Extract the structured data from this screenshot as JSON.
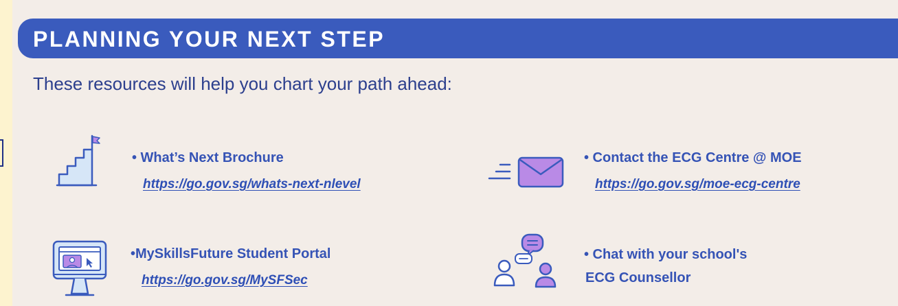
{
  "header": {
    "title": "PLANNING YOUR NEXT STEP"
  },
  "intro": {
    "text": "These resources will help you chart your path ahead:"
  },
  "resources": [
    {
      "icon": "stairs-flag-icon",
      "title": "• What’s Next Brochure",
      "link": "https://go.gov.sg/whats-next-nlevel"
    },
    {
      "icon": "envelope-icon",
      "title": "• Contact the ECG Centre @ MOE",
      "link": "https://go.gov.sg/moe-ecg-centre"
    },
    {
      "icon": "computer-portal-icon",
      "title": "•MySkillsFuture Student Portal",
      "link": "https://go.gov.sg/MySFSec"
    },
    {
      "icon": "chat-people-icon",
      "title": "• Chat with your school's",
      "subtitle": "ECG Counsellor"
    }
  ],
  "colors": {
    "header_blue": "#3a5bbd",
    "text_blue": "#3553b5",
    "icon_outline": "#3a5bbd",
    "icon_light_fill": "#d6e6f7",
    "icon_purple": "#b98ae6",
    "panel_bg": "#f3ede8",
    "outer_bg": "#fdf3cf"
  }
}
